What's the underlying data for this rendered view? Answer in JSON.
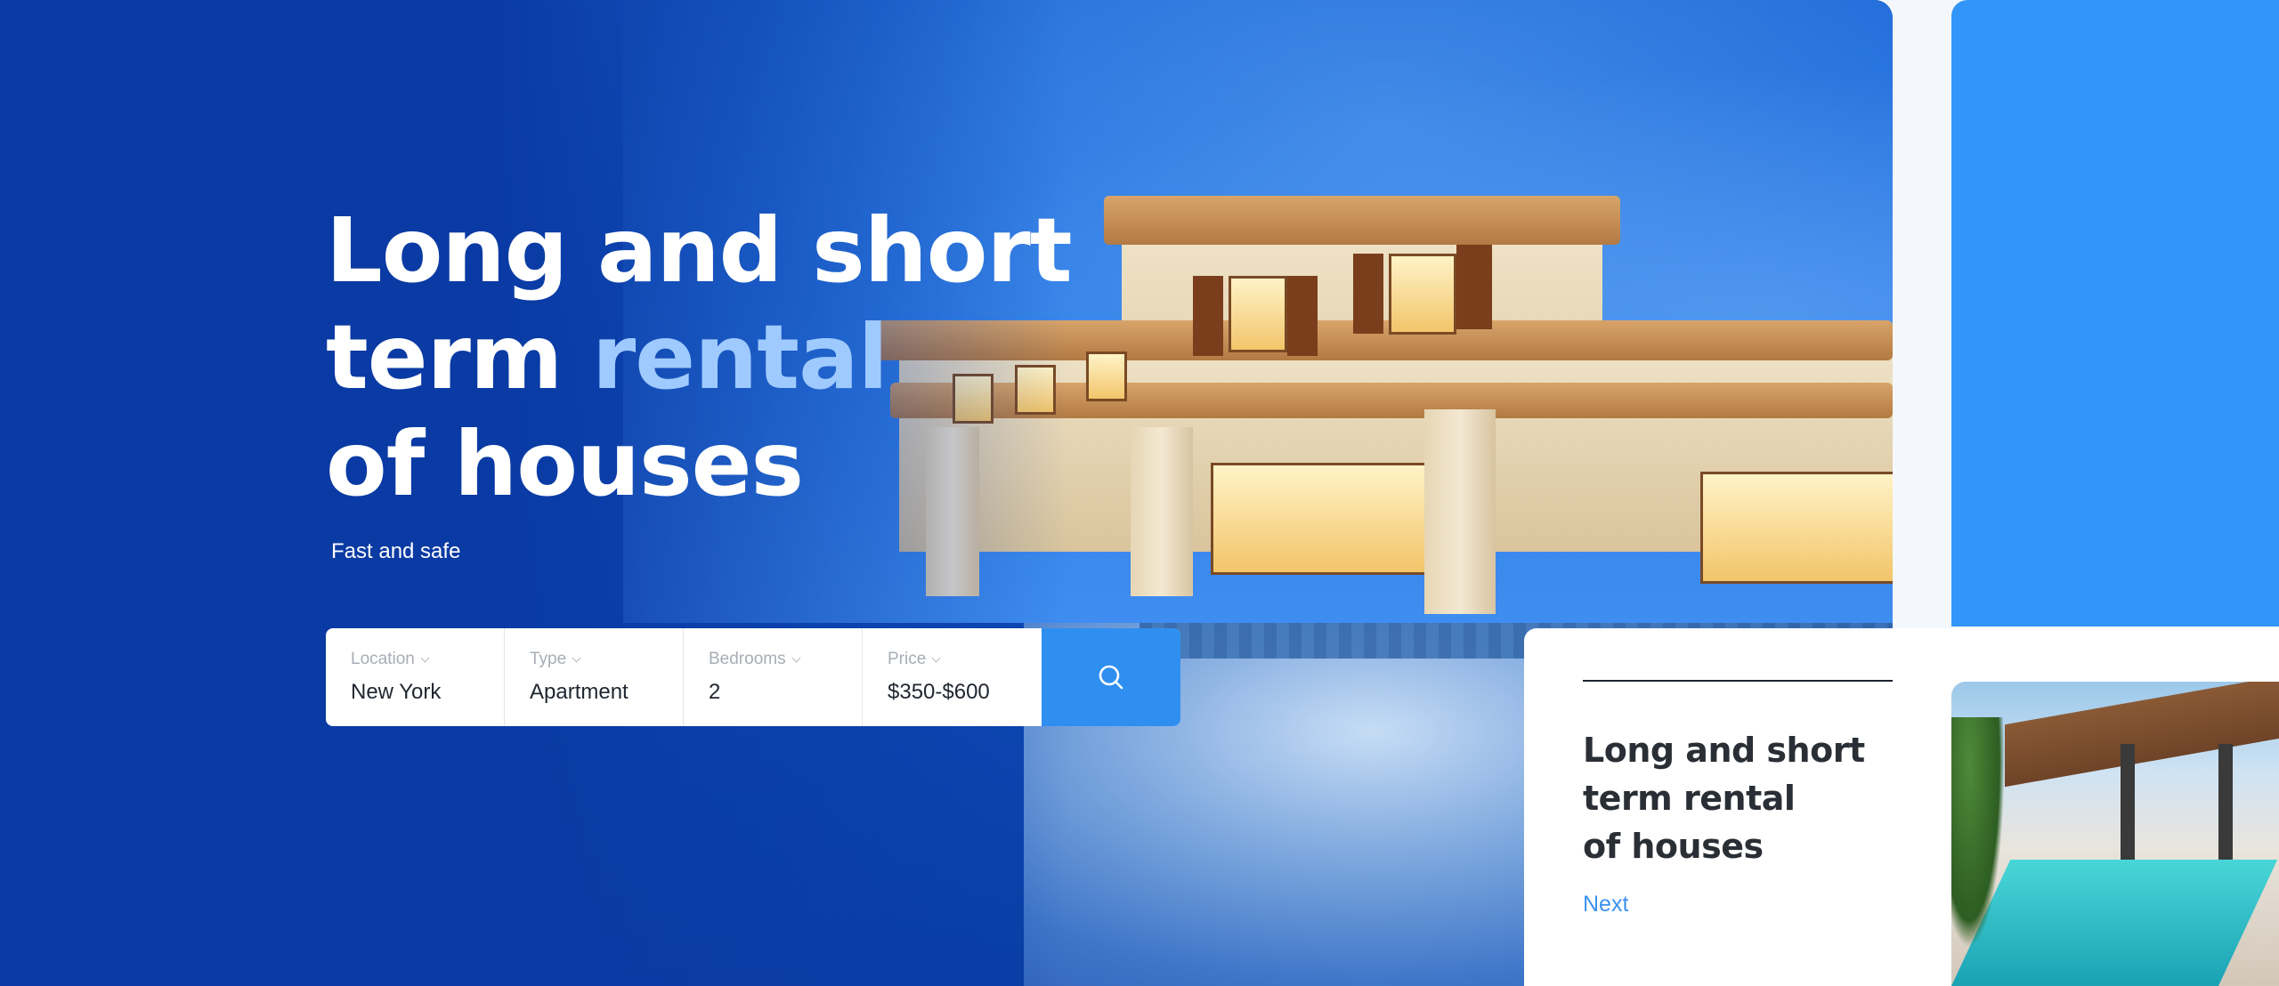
{
  "hero": {
    "headline_line1": "Long and short",
    "headline_line2_a": "term ",
    "headline_line2_accent": "rental",
    "headline_line3": "of houses",
    "subtitle": "Fast and safe"
  },
  "search": {
    "fields": [
      {
        "label": "Location",
        "value": "New York"
      },
      {
        "label": "Type",
        "value": "Apartment"
      },
      {
        "label": "Bedrooms",
        "value": "2"
      },
      {
        "label": "Price",
        "value": "$350-$600"
      }
    ],
    "button_icon": "search-icon"
  },
  "card": {
    "title_line1": "Long and short",
    "title_line2": "term rental",
    "title_line3": "of houses",
    "next_label": "Next"
  },
  "colors": {
    "hero_blue": "#0a3aa3",
    "accent_blue": "#2f8ff0",
    "headline_accent": "#9fcaff",
    "panel_blue": "#3196f7"
  }
}
